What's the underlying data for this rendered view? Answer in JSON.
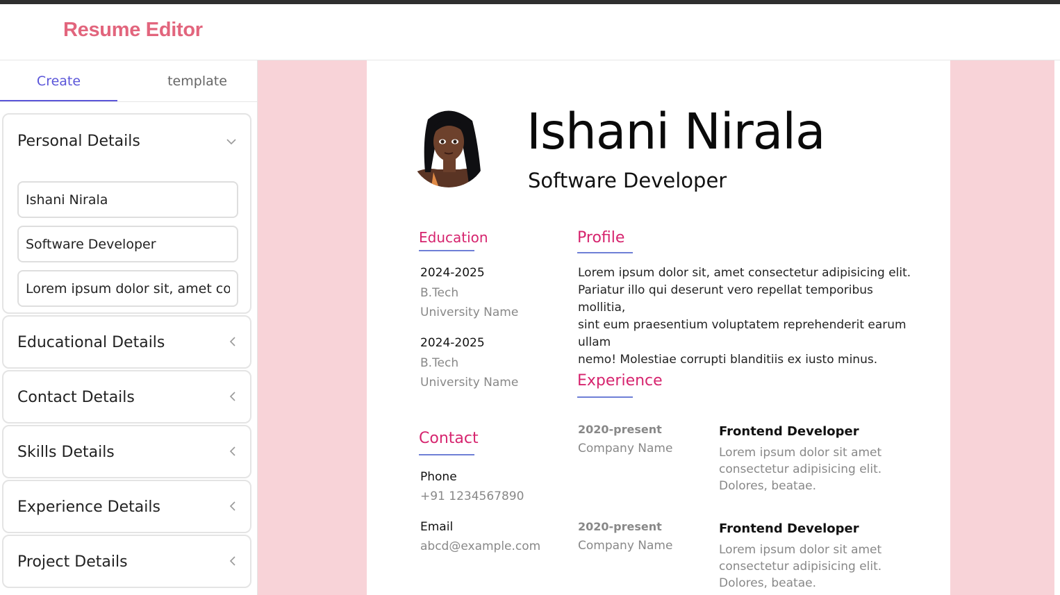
{
  "app": {
    "title": "Resume Editor"
  },
  "tabs": [
    {
      "label": "Create",
      "active": true
    },
    {
      "label": "template",
      "active": false
    }
  ],
  "panels": {
    "personal": {
      "title": "Personal Details",
      "expanded": true,
      "fields": [
        {
          "value": "Ishani Nirala"
        },
        {
          "value": "Software Developer"
        },
        {
          "value": "Lorem ipsum dolor sit, amet consectetur adipisicing elit."
        }
      ]
    },
    "educational": {
      "title": "Educational Details"
    },
    "contact": {
      "title": "Contact Details"
    },
    "skills": {
      "title": "Skills Details"
    },
    "experience": {
      "title": "Experience Details"
    },
    "project": {
      "title": "Project Details"
    }
  },
  "resume": {
    "name": "Ishani Nirala",
    "role": "Software Developer",
    "education": {
      "heading": "Education",
      "items": [
        {
          "years": "2024-2025",
          "degree": "B.Tech",
          "school": "University Name"
        },
        {
          "years": "2024-2025",
          "degree": "B.Tech",
          "school": "University Name"
        }
      ]
    },
    "profile": {
      "heading": "Profile",
      "lines": [
        "Lorem ipsum dolor sit, amet consectetur adipisicing elit.",
        "Pariatur illo qui deserunt vero repellat temporibus mollitia,",
        "sint eum praesentium voluptatem reprehenderit earum ullam",
        "nemo! Molestiae corrupti blanditiis ex iusto minus."
      ]
    },
    "contact": {
      "heading": "Contact",
      "phone_label": "Phone",
      "phone": "+91 1234567890",
      "email_label": "Email",
      "email": "abcd@example.com"
    },
    "experience": {
      "heading": "Experience",
      "items": [
        {
          "period": "2020-present",
          "company": "Company Name",
          "title": "Frontend Developer",
          "desc": [
            "Lorem ipsum dolor sit amet",
            "consectetur adipisicing elit.",
            "Dolores, beatae."
          ]
        },
        {
          "period": "2020-present",
          "company": "Company Name",
          "title": "Frontend Developer",
          "desc": [
            "Lorem ipsum dolor sit amet",
            "consectetur adipisicing elit.",
            "Dolores, beatae."
          ]
        }
      ]
    }
  },
  "colors": {
    "brand": "#e2657d",
    "accent": "#5a55d9",
    "section_heading": "#d6246e",
    "section_rule": "#6e7fd6",
    "canvas_bg": "#f8d3d8"
  },
  "icons": {
    "expanded": "chevron-down-icon",
    "collapsed": "chevron-left-icon"
  }
}
